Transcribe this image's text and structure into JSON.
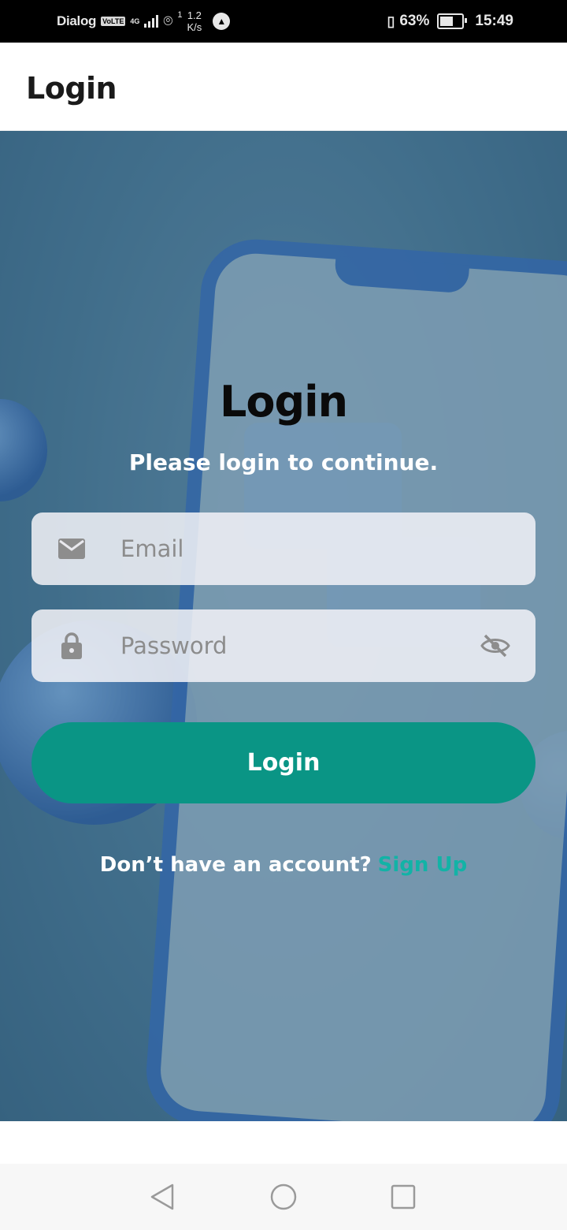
{
  "status_bar": {
    "carrier": "Dialog",
    "volte": "VoLTE",
    "network": "4G",
    "hotspot_count": "1",
    "speed_value": "1.2",
    "speed_unit": "K/s",
    "battery_percent": "63%",
    "battery_level": 0.63,
    "time": "15:49"
  },
  "app_bar": {
    "title": "Login"
  },
  "form": {
    "heading": "Login",
    "subtitle": "Please login to continue.",
    "email_placeholder": "Email",
    "password_placeholder": "Password",
    "login_button": "Login",
    "signup_prompt": "Don’t have an account?",
    "signup_link": "Sign Up"
  },
  "colors": {
    "accent": "#0a9585",
    "link": "#12b3a6",
    "status_bar_bg": "#000000"
  },
  "icons": {
    "email": "mail-icon",
    "password": "lock-icon",
    "toggle_visibility": "eye-off-icon",
    "nav_back": "back-triangle-icon",
    "nav_home": "home-circle-icon",
    "nav_recent": "recent-square-icon"
  }
}
